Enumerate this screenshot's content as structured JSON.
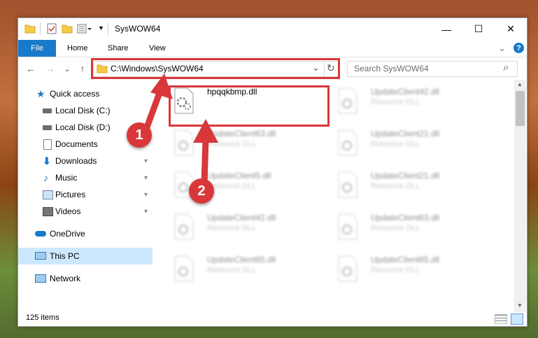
{
  "window": {
    "title": "SysWOW64",
    "minimize_icon": "—",
    "maximize_icon": "☐",
    "close_icon": "✕"
  },
  "ribbon": {
    "tabs": [
      "File",
      "Home",
      "Share",
      "View"
    ],
    "expand_icon": "⌄",
    "help_icon": "?"
  },
  "nav": {
    "back_icon": "←",
    "forward_icon": "→",
    "recent_icon": "⌄",
    "up_icon": "↑",
    "address": "C:\\Windows\\SysWOW64",
    "dropdown_icon": "⌄",
    "refresh_icon": "↻",
    "search_placeholder": "Search SysWOW64",
    "search_icon": "⌕"
  },
  "sidebar": {
    "items": [
      {
        "label": "Quick access",
        "icon": "star-icon",
        "pinned": false
      },
      {
        "label": "Local Disk (C:)",
        "icon": "drive-icon",
        "pinned": false
      },
      {
        "label": "Local Disk (D:)",
        "icon": "drive-icon",
        "pinned": false
      },
      {
        "label": "Documents",
        "icon": "documents-icon",
        "pinned": false
      },
      {
        "label": "Downloads",
        "icon": "downloads-icon",
        "pinned": true
      },
      {
        "label": "Music",
        "icon": "music-icon",
        "pinned": true
      },
      {
        "label": "Pictures",
        "icon": "pictures-icon",
        "pinned": true
      },
      {
        "label": "Videos",
        "icon": "videos-icon",
        "pinned": true
      },
      {
        "label": "OneDrive",
        "icon": "onedrive-icon",
        "pinned": false
      },
      {
        "label": "This PC",
        "icon": "pc-icon",
        "pinned": false
      },
      {
        "label": "Network",
        "icon": "network-icon",
        "pinned": false
      }
    ],
    "pin_icon": "📌"
  },
  "files": {
    "highlighted": {
      "name": "hpqqkbmp.dll"
    },
    "blurred": [
      {
        "name": "UpdateClient42.dll",
        "type": "Resource DLL"
      },
      {
        "name": "UpdateClient63.dll",
        "type": "Resource DLL"
      },
      {
        "name": "UpdateClient21.dll",
        "type": "Resource DLL"
      },
      {
        "name": "UpdateClient5.dll",
        "type": "Resource DLL"
      },
      {
        "name": "UpdateClient21.dll",
        "type": "Resource DLL"
      },
      {
        "name": "UpdateClient42.dll",
        "type": "Resource DLL"
      },
      {
        "name": "UpdateClient63.dll",
        "type": "Resource DLL"
      },
      {
        "name": "UpdateClient65.dll",
        "type": "Resource DLL"
      },
      {
        "name": "UpdateClient65.dll",
        "type": "Resource DLL"
      }
    ]
  },
  "status": {
    "item_count": "125 items"
  },
  "annotations": {
    "step1": "1",
    "step2": "2",
    "color": "#d9383a"
  }
}
